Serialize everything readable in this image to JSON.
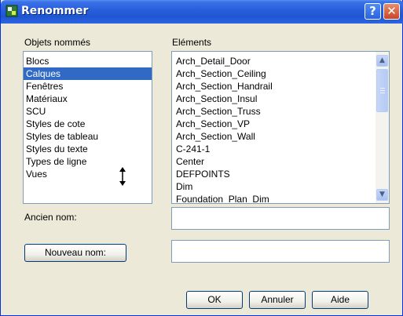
{
  "window": {
    "title": "Renommer",
    "help_label": "?",
    "close_label": "✕"
  },
  "named_objects": {
    "label": "Objets nommés",
    "items": [
      "Blocs",
      "Calques",
      "Fenêtres",
      "Matériaux",
      "SCU",
      "Styles de cote",
      "Styles de tableau",
      "Styles du texte",
      "Types de ligne",
      "Vues"
    ],
    "selected": "Calques"
  },
  "elements": {
    "label": "Eléments",
    "items": [
      "Arch_Detail_Door",
      "Arch_Section_Ceiling",
      "Arch_Section_Handrail",
      "Arch_Section_Insul",
      "Arch_Section_Truss",
      "Arch_Section_VP",
      "Arch_Section_Wall",
      "C-241-1",
      "Center",
      "DEFPOINTS",
      "Dim",
      "Foundation_Plan_Dim"
    ]
  },
  "old_name": {
    "label": "Ancien nom:",
    "value": ""
  },
  "new_name": {
    "button_label": "Nouveau nom:",
    "value": ""
  },
  "buttons": {
    "ok": "OK",
    "cancel": "Annuler",
    "help": "Aide"
  },
  "icons": [
    "app-icon",
    "help-icon",
    "close-icon",
    "scroll-up-icon",
    "scroll-down-icon",
    "resize-cursor-icon"
  ]
}
